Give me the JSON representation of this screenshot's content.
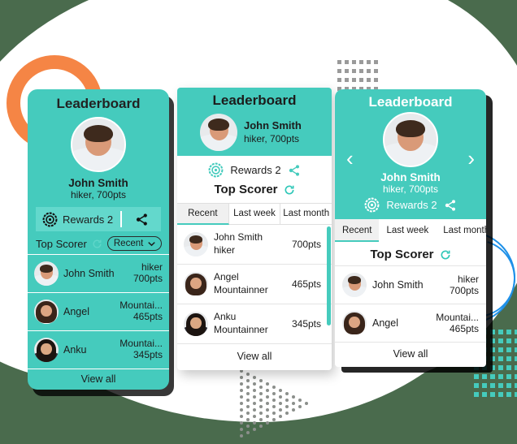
{
  "theme": {
    "teal": "#45cbbd",
    "teal_light": "#63d8cc",
    "orange": "#f58545",
    "bg_green": "#4a6b4d",
    "blue": "#1e90e8"
  },
  "left_card": {
    "title": "Leaderboard",
    "user": {
      "name": "John Smith",
      "subtitle": "hiker, 700pts"
    },
    "rewards_label": "Rewards 2",
    "rewards_icon": "badge-gear-icon",
    "share_icon": "share-icon",
    "top_scorer_label": "Top Scorer",
    "refresh_icon": "refresh-icon",
    "filter_value": "Recent",
    "chevron_icon": "chevron-down-icon",
    "rows": [
      {
        "name": "John Smith",
        "role": "hiker",
        "points": "700pts",
        "avatar": "john"
      },
      {
        "name": "Angel",
        "role": "Mountai...",
        "points": "465pts",
        "avatar": "angel"
      },
      {
        "name": "Anku",
        "role": "Mountai...",
        "points": "345pts",
        "avatar": "anku"
      }
    ],
    "view_all": "View all"
  },
  "mid_card": {
    "title": "Leaderboard",
    "user": {
      "name": "John Smith",
      "subtitle": "hiker, 700pts"
    },
    "rewards_label": "Rewards 2",
    "rewards_icon": "badge-gear-icon",
    "share_icon": "share-icon",
    "top_scorer_label": "Top Scorer",
    "refresh_icon": "refresh-icon",
    "tabs": [
      {
        "label": "Recent",
        "active": true
      },
      {
        "label": "Last week",
        "active": false
      },
      {
        "label": "Last month",
        "active": false
      }
    ],
    "rows": [
      {
        "name": "John Smith",
        "role": "hiker",
        "points": "700pts",
        "avatar": "john"
      },
      {
        "name": "Angel",
        "role": "Mountainner",
        "points": "465pts",
        "avatar": "angel"
      },
      {
        "name": "Anku",
        "role": "Mountainner",
        "points": "345pts",
        "avatar": "anku"
      }
    ],
    "view_all": "View all"
  },
  "right_card": {
    "title": "Leaderboard",
    "user": {
      "name": "John Smith",
      "subtitle": "hiker, 700pts"
    },
    "rewards_label": "Rewards 2",
    "rewards_icon": "badge-gear-icon",
    "share_icon": "share-icon",
    "prev_icon": "chevron-left-icon",
    "next_icon": "chevron-right-icon",
    "prev_glyph": "‹",
    "next_glyph": "›",
    "top_scorer_label": "Top Scorer",
    "refresh_icon": "refresh-icon",
    "tabs": [
      {
        "label": "Recent",
        "active": true
      },
      {
        "label": "Last week",
        "active": false
      },
      {
        "label": "Last month",
        "active": false
      }
    ],
    "rows": [
      {
        "name": "John Smith",
        "role": "hiker",
        "points": "700pts",
        "avatar": "john"
      },
      {
        "name": "Angel",
        "role": "Mountai...",
        "points": "465pts",
        "avatar": "angel"
      }
    ],
    "view_all": "View all"
  },
  "decorations": {
    "orange_ring": "orange-ring-shape",
    "gray_dot_grid": "gray-dot-grid",
    "teal_dot_grid": "teal-dot-grid",
    "triangle_dots": "triangle-dot-pattern",
    "blue_arcs": "blue-arc-shape"
  }
}
